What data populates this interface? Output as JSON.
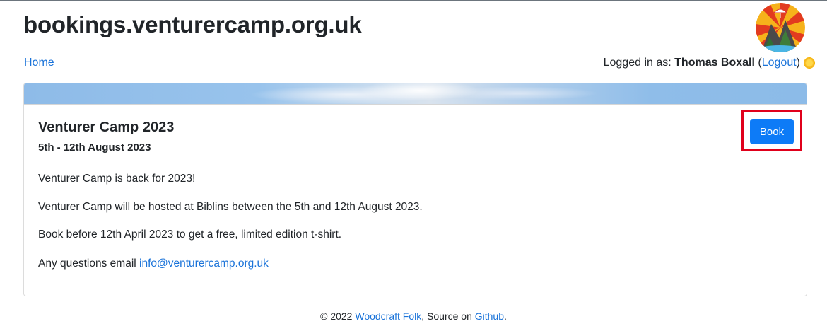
{
  "header": {
    "site_title": "bookings.venturercamp.org.uk"
  },
  "nav": {
    "home_label": "Home",
    "logged_in_prefix": "Logged in as: ",
    "user_name": "Thomas Boxall",
    "logout_open": "(",
    "logout_label": "Logout",
    "logout_close": ")"
  },
  "event": {
    "title": "Venturer Camp 2023",
    "dates": "5th - 12th August 2023",
    "book_label": "Book",
    "paragraphs": [
      "Venturer Camp is back for 2023!",
      "Venturer Camp will be hosted at Biblins between the 5th and 12th August 2023.",
      "Book before 12th April 2023 to get a free, limited edition t-shirt."
    ],
    "questions_prefix": "Any questions email ",
    "email": "info@venturercamp.org.uk"
  },
  "footer": {
    "copyright": "© 2022 ",
    "org_link": "Woodcraft Folk",
    "source_text": ", Source on ",
    "github_link": "Github",
    "end": "."
  },
  "colors": {
    "link": "#1a73d9",
    "button": "#0d7bf7",
    "highlight": "#e0001b"
  }
}
